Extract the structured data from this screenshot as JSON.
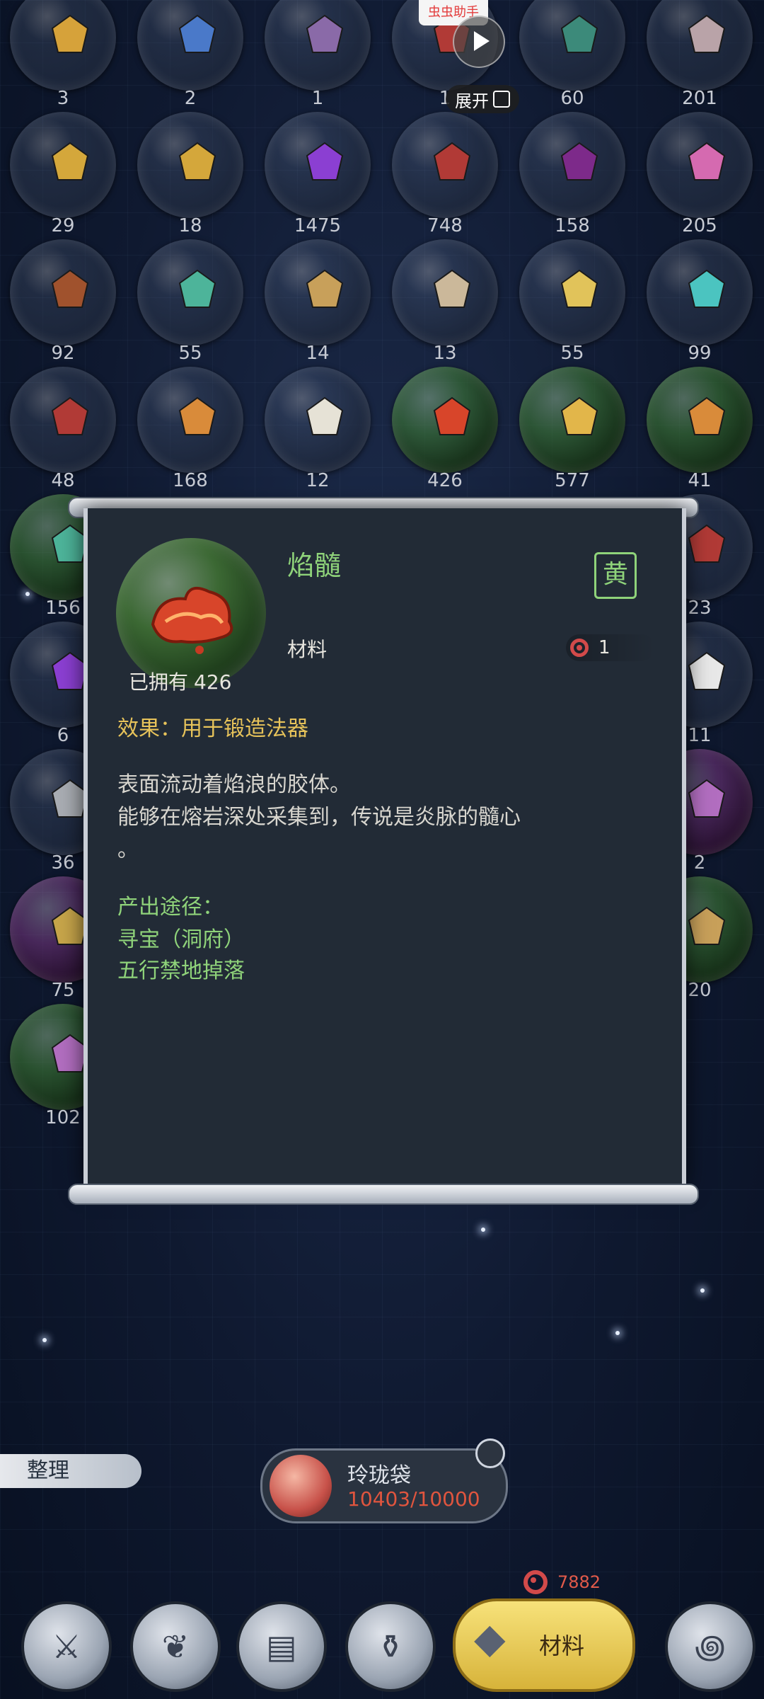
{
  "overlay": {
    "helper_label": "虫虫助手",
    "expand_label": "展开"
  },
  "inventory": {
    "rows": [
      [
        {
          "count": "3",
          "rarity": "normal",
          "icon": "amber-orb-icon",
          "color": "#d6a23a"
        },
        {
          "count": "2",
          "rarity": "normal",
          "icon": "blue-orb-icon",
          "color": "#4a79c9"
        },
        {
          "count": "1",
          "rarity": "normal",
          "icon": "flower-icon",
          "color": "#8a6aa8"
        },
        {
          "count": "1",
          "rarity": "normal",
          "icon": "blood-bowl-icon",
          "color": "#b13a36"
        },
        {
          "count": "60",
          "rarity": "normal",
          "icon": "herb-stalk-icon",
          "color": "#3c8a7a"
        },
        {
          "count": "201",
          "rarity": "normal",
          "icon": "rock-icon",
          "color": "#b9a3a8"
        }
      ],
      [
        {
          "count": "29",
          "rarity": "normal",
          "icon": "gold-feather-icon",
          "color": "#d4a73b"
        },
        {
          "count": "18",
          "rarity": "normal",
          "icon": "gold-feather-icon",
          "color": "#d4a73b"
        },
        {
          "count": "1475",
          "rarity": "normal",
          "icon": "purple-crystal-icon",
          "color": "#8b3fd2"
        },
        {
          "count": "748",
          "rarity": "normal",
          "icon": "blood-bowl-icon",
          "color": "#b13a36"
        },
        {
          "count": "158",
          "rarity": "normal",
          "icon": "violet-shard-icon",
          "color": "#7d2a8a"
        },
        {
          "count": "205",
          "rarity": "normal",
          "icon": "pink-crystal-icon",
          "color": "#d56ab0"
        }
      ],
      [
        {
          "count": "92",
          "rarity": "normal",
          "icon": "wood-branch-icon",
          "color": "#a0522d"
        },
        {
          "count": "55",
          "rarity": "normal",
          "icon": "jade-stone-icon",
          "color": "#4db49a"
        },
        {
          "count": "14",
          "rarity": "normal",
          "icon": "ginseng-icon",
          "color": "#c8a05a"
        },
        {
          "count": "13",
          "rarity": "normal",
          "icon": "mushroom-icon",
          "color": "#cbb89a"
        },
        {
          "count": "55",
          "rarity": "normal",
          "icon": "potion-flask-icon",
          "color": "#e1c35a"
        },
        {
          "count": "99",
          "rarity": "normal",
          "icon": "teal-flower-icon",
          "color": "#4bc4c0"
        }
      ],
      [
        {
          "count": "48",
          "rarity": "normal",
          "icon": "blood-bowl-icon",
          "color": "#b13a36"
        },
        {
          "count": "168",
          "rarity": "normal",
          "icon": "tiger-pelt-icon",
          "color": "#d98b3a"
        },
        {
          "count": "12",
          "rarity": "normal",
          "icon": "lotus-icon",
          "color": "#e6e2d6"
        },
        {
          "count": "426",
          "rarity": "green",
          "icon": "flame-marrow-icon",
          "color": "#d8452a"
        },
        {
          "count": "577",
          "rarity": "green",
          "icon": "gold-ore-icon",
          "color": "#e2b64a"
        },
        {
          "count": "41",
          "rarity": "green",
          "icon": "tiger-pelt-icon",
          "color": "#d98b3a"
        }
      ],
      [
        {
          "count": "156",
          "rarity": "green",
          "icon": "jade-stone-icon",
          "color": "#4db49a"
        },
        {
          "count": "",
          "rarity": "normal",
          "icon": "",
          "color": "#333"
        },
        {
          "count": "",
          "rarity": "normal",
          "icon": "",
          "color": "#333"
        },
        {
          "count": "",
          "rarity": "normal",
          "icon": "",
          "color": "#333"
        },
        {
          "count": "",
          "rarity": "normal",
          "icon": "",
          "color": "#333"
        },
        {
          "count": "23",
          "rarity": "normal",
          "icon": "blood-bowl-icon",
          "color": "#b13a36"
        }
      ],
      [
        {
          "count": "6",
          "rarity": "normal",
          "icon": "purple-crystal-icon",
          "color": "#8b3fd2"
        },
        {
          "count": "",
          "rarity": "normal",
          "icon": "",
          "color": "#333"
        },
        {
          "count": "",
          "rarity": "normal",
          "icon": "",
          "color": "#333"
        },
        {
          "count": "",
          "rarity": "normal",
          "icon": "",
          "color": "#333"
        },
        {
          "count": "",
          "rarity": "normal",
          "icon": "",
          "color": "#333"
        },
        {
          "count": "11",
          "rarity": "normal",
          "icon": "white-beans-icon",
          "color": "#e8e8e8"
        }
      ],
      [
        {
          "count": "36",
          "rarity": "normal",
          "icon": "grey-rock-icon",
          "color": "#a9adb3"
        },
        {
          "count": "",
          "rarity": "normal",
          "icon": "",
          "color": "#333"
        },
        {
          "count": "",
          "rarity": "normal",
          "icon": "",
          "color": "#333"
        },
        {
          "count": "",
          "rarity": "normal",
          "icon": "",
          "color": "#333"
        },
        {
          "count": "",
          "rarity": "normal",
          "icon": "",
          "color": "#333"
        },
        {
          "count": "2",
          "rarity": "purple",
          "icon": "lavender-herb-icon",
          "color": "#b26ec0"
        }
      ],
      [
        {
          "count": "75",
          "rarity": "purple",
          "icon": "gold-root-icon",
          "color": "#c7a54a"
        },
        {
          "count": "",
          "rarity": "normal",
          "icon": "",
          "color": "#333"
        },
        {
          "count": "",
          "rarity": "normal",
          "icon": "",
          "color": "#333"
        },
        {
          "count": "",
          "rarity": "normal",
          "icon": "",
          "color": "#333"
        },
        {
          "count": "",
          "rarity": "normal",
          "icon": "",
          "color": "#333"
        },
        {
          "count": "20",
          "rarity": "green",
          "icon": "ginseng-icon",
          "color": "#c8a05a"
        }
      ],
      [
        {
          "count": "102",
          "rarity": "green",
          "icon": "lavender-herb-icon",
          "color": "#b26ec0"
        },
        {
          "count": "",
          "rarity": "normal",
          "icon": "",
          "color": "#333"
        },
        {
          "count": "",
          "rarity": "normal",
          "icon": "",
          "color": "#333"
        },
        {
          "count": "",
          "rarity": "normal",
          "icon": "",
          "color": "#333"
        },
        {
          "count": "",
          "rarity": "normal",
          "icon": "",
          "color": "#333"
        },
        {
          "count": "",
          "rarity": "normal",
          "icon": "",
          "color": "#333"
        }
      ]
    ]
  },
  "detail": {
    "name": "焰髓",
    "quality_stamp": "黄",
    "type_label": "材料",
    "cost": "1",
    "owned_label": "已拥有",
    "owned_count": "426",
    "effect": "效果：用于锻造法器",
    "description_line1": "表面流动着焰浪的胶体。",
    "description_line2": "能够在熔岩深处采集到，传说是炎脉的髓心",
    "description_line3": "。",
    "source_title": "产出途径：",
    "sources": [
      "寻宝（洞府）",
      "五行禁地掉落"
    ],
    "accent": "#8fd37a",
    "effect_color": "#e7c35a"
  },
  "bottom": {
    "sort_label": "整理",
    "bag_name": "玲珑袋",
    "bag_capacity": "10403/10000",
    "currency": "7882",
    "tabs": [
      {
        "icon": "sword-shield-icon"
      },
      {
        "icon": "pouch-icon"
      },
      {
        "icon": "book-icon"
      },
      {
        "icon": "potion-icon"
      },
      {
        "icon": "crystal-icon",
        "label": "材料",
        "active": true
      },
      {
        "icon": "swirl-icon"
      }
    ]
  }
}
